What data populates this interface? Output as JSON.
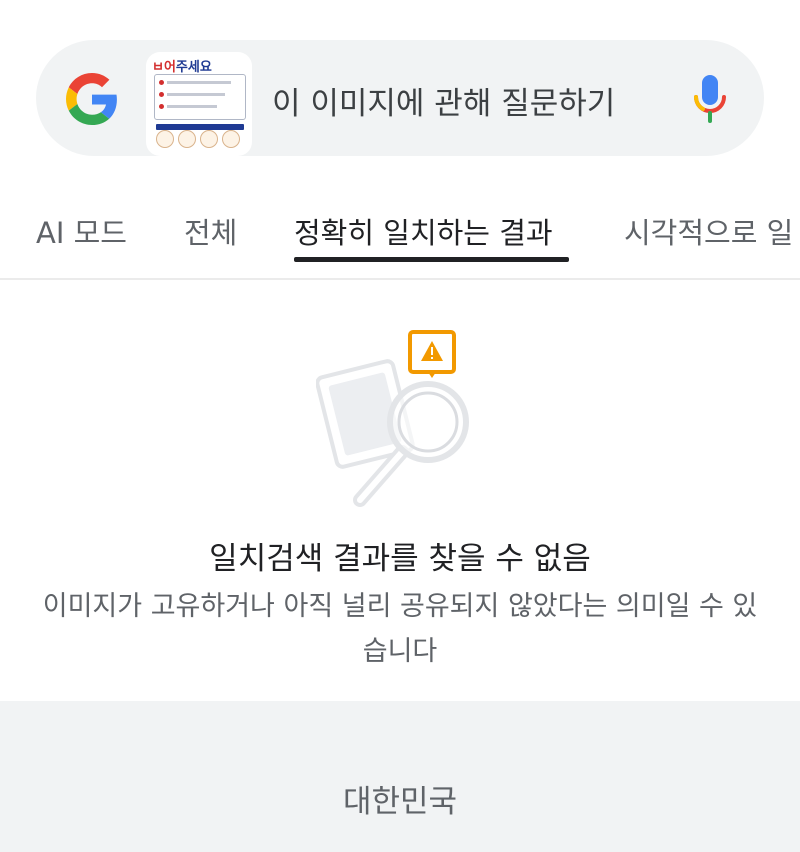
{
  "search_bar": {
    "prompt": "이 이미지에 관해 질문하기",
    "thumbnail_title_red": "ㅂ어",
    "thumbnail_title_blue": "주세요"
  },
  "tabs": [
    {
      "label": "AI 모드",
      "active": false
    },
    {
      "label": "전체",
      "active": false
    },
    {
      "label": "정확히 일치하는 결과",
      "active": true
    },
    {
      "label": "시각적으로 일",
      "active": false
    }
  ],
  "empty_state": {
    "title": "일치검색 결과를 찾을 수 없음",
    "description": "이미지가 고유하거나 아직 널리 공유되지 않았다는 의미일 수 있습니다"
  },
  "footer": {
    "region": "대한민국"
  },
  "colors": {
    "search_bg": "#f1f3f4",
    "warning": "#f29900",
    "active_tab": "#202124",
    "muted_text": "#5f6368"
  }
}
